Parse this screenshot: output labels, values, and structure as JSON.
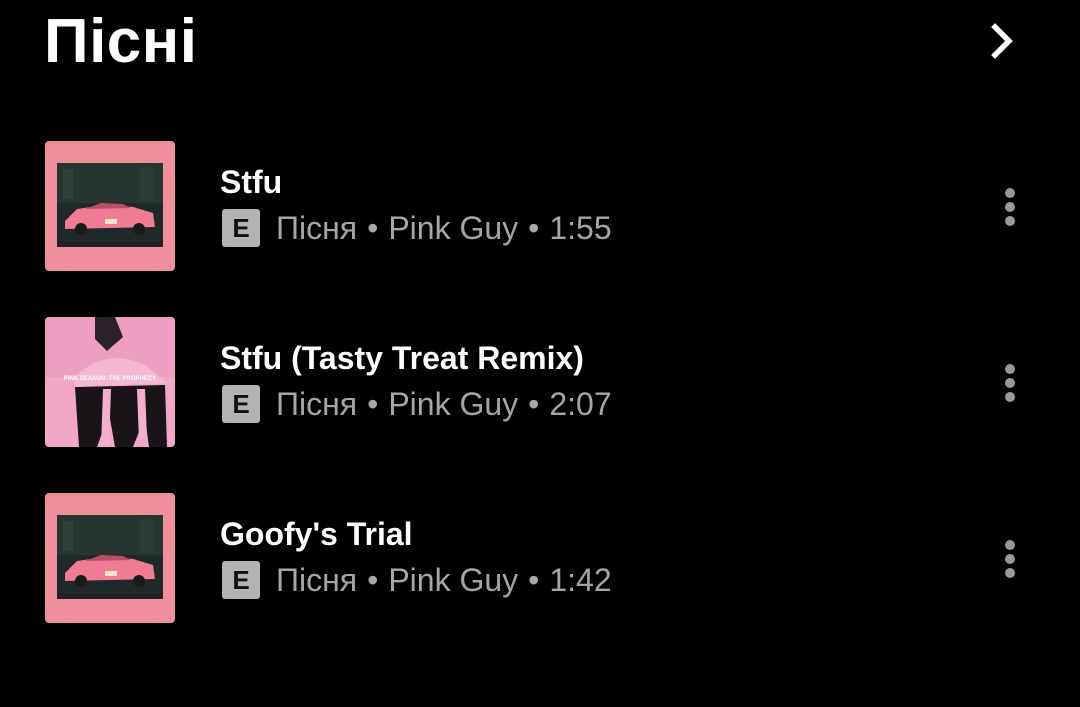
{
  "header": {
    "title": "Пісні",
    "more_icon": "chevron-right-icon"
  },
  "songs": [
    {
      "title": "Stfu",
      "explicit_badge": "E",
      "type": "Пісня",
      "artist": "Pink Guy",
      "duration": "1:55",
      "artwork": "car-artwork",
      "menu_icon": "more-vert-icon"
    },
    {
      "title": "Stfu (Tasty Treat Remix)",
      "explicit_badge": "E",
      "type": "Пісня",
      "artist": "Pink Guy",
      "duration": "2:07",
      "artwork": "pink-season-prophecy-artwork",
      "artwork_text": "PINK SEASON: THE PROPHECY",
      "menu_icon": "more-vert-icon"
    },
    {
      "title": "Goofy's Trial",
      "explicit_badge": "E",
      "type": "Пісня",
      "artist": "Pink Guy",
      "duration": "1:42",
      "artwork": "car-artwork",
      "menu_icon": "more-vert-icon"
    }
  ],
  "separator": "•",
  "colors": {
    "background": "#000000",
    "title_text": "#ffffff",
    "secondary_text": "#a6a6a6",
    "explicit_badge": "#b3b3b3",
    "artwork_pink": "#f08f9f"
  }
}
